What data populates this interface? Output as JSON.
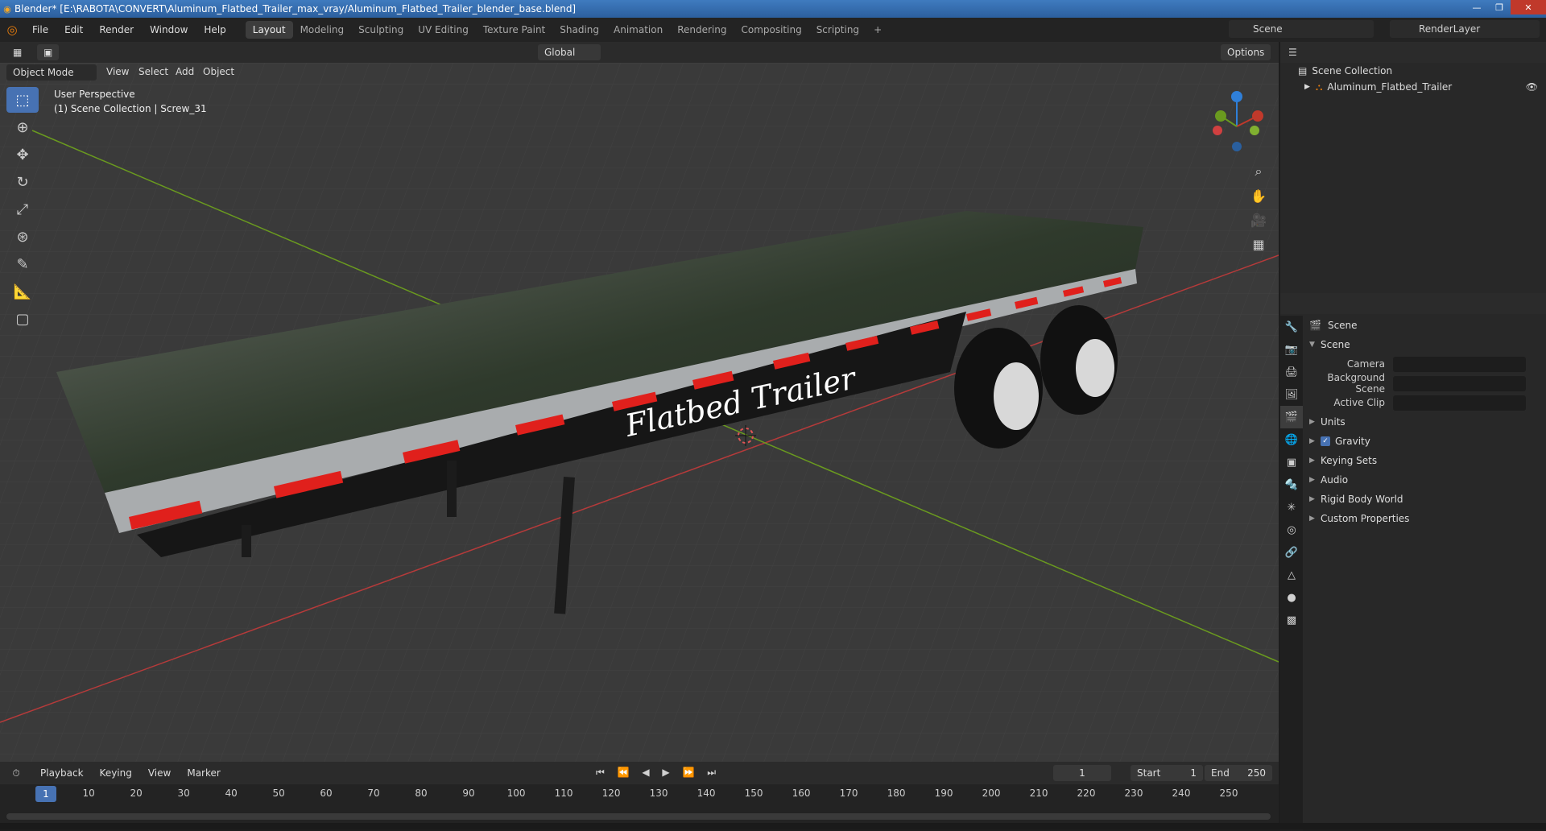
{
  "window": {
    "title": "Blender* [E:\\RABOTA\\CONVERT\\Aluminum_Flatbed_Trailer_max_vray/Aluminum_Flatbed_Trailer_blender_base.blend]"
  },
  "menu": [
    "File",
    "Edit",
    "Render",
    "Window",
    "Help"
  ],
  "workspaces": [
    "Layout",
    "Modeling",
    "Sculpting",
    "UV Editing",
    "Texture Paint",
    "Shading",
    "Animation",
    "Rendering",
    "Compositing",
    "Scripting"
  ],
  "active_workspace": "Layout",
  "scene_name": "Scene",
  "render_layer": "RenderLayer",
  "viewport": {
    "mode": "Object Mode",
    "menus": [
      "View",
      "Select",
      "Add",
      "Object"
    ],
    "transform_orientation": "Global",
    "options_label": "Options",
    "perspective": "User Perspective",
    "collection_info": "(1) Scene Collection | Screw_31",
    "decal_text": "Flatbed Trailer"
  },
  "outliner": {
    "root": "Scene Collection",
    "items": [
      {
        "label": "Aluminum_Flatbed_Trailer"
      }
    ]
  },
  "properties": {
    "header": "Scene",
    "section": "Scene",
    "fields": [
      {
        "label": "Camera",
        "value": ""
      },
      {
        "label": "Background Scene",
        "value": ""
      },
      {
        "label": "Active Clip",
        "value": ""
      }
    ],
    "subsections": [
      "Units",
      "Gravity",
      "Keying Sets",
      "Audio",
      "Rigid Body World",
      "Custom Properties"
    ],
    "gravity_checked": true
  },
  "timeline": {
    "menus": [
      "Playback",
      "Keying",
      "View",
      "Marker"
    ],
    "current_frame": "1",
    "start_label": "Start",
    "start": "1",
    "end_label": "End",
    "end": "250",
    "ticks": [
      "1",
      "10",
      "20",
      "30",
      "40",
      "50",
      "60",
      "70",
      "80",
      "90",
      "100",
      "110",
      "120",
      "130",
      "140",
      "150",
      "160",
      "170",
      "180",
      "190",
      "200",
      "210",
      "220",
      "230",
      "240",
      "250"
    ]
  },
  "colors": {
    "accent": "#4772b3",
    "orange": "#e87d0d",
    "x_axis": "#c0392b",
    "y_axis": "#6a9a1f",
    "z_axis": "#2f7fd8",
    "trailer_stripe": "#e0201c"
  }
}
